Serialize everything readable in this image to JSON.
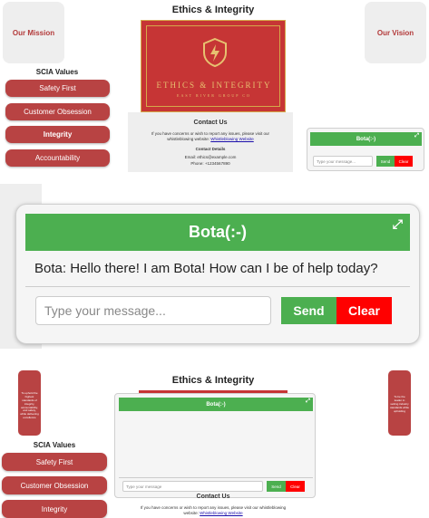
{
  "top": {
    "mission_label": "Our Mission",
    "vision_label": "Our Vision",
    "page_title": "Ethics & Integrity",
    "values_title": "SCIA Values",
    "values": [
      "Safety First",
      "Customer Obsession",
      "Integrity",
      "Accountability"
    ],
    "poster_title": "ETHICS & INTEGRITY",
    "poster_subtitle": "EAST RIVER GROUP CO",
    "contact": {
      "title": "Contact Us",
      "text": "If you have concerns or wish to report any issues, please visit our whistleblowing website:",
      "link": "Whistleblowing Website",
      "details_title": "Contact Details",
      "email": "Email: ethics@example.com",
      "phone": "Phone: +1234567890"
    },
    "mini_chat": {
      "title": "Bota(:-)",
      "placeholder": "Type your message...",
      "send": "Send",
      "clear": "Clear"
    }
  },
  "main_chat": {
    "title": "Bota(:-)",
    "greeting": "Bota: Hello there! I am Bota! How can I be of help today?",
    "placeholder": "Type your message...",
    "send": "Send",
    "clear": "Clear"
  },
  "bottom": {
    "page_title": "Ethics & Integrity",
    "values_title": "SCIA Values",
    "values": [
      "Safety First",
      "Customer Obsession",
      "Integrity"
    ],
    "left_card_text": "To uphold the highest standards of integrity, accountability, and safety, while delivering excellence",
    "right_card_text": "To be the leader in setting industry standards while upholding",
    "chat": {
      "title": "Bota(:-)",
      "placeholder": "Type your message",
      "send": "Send",
      "clear": "Clear"
    },
    "contact_title": "Contact Us",
    "contact_text": "If you have concerns or wish to report any issues, please visit our whistleblowing website:",
    "contact_link": "Whistleblowing Website"
  }
}
